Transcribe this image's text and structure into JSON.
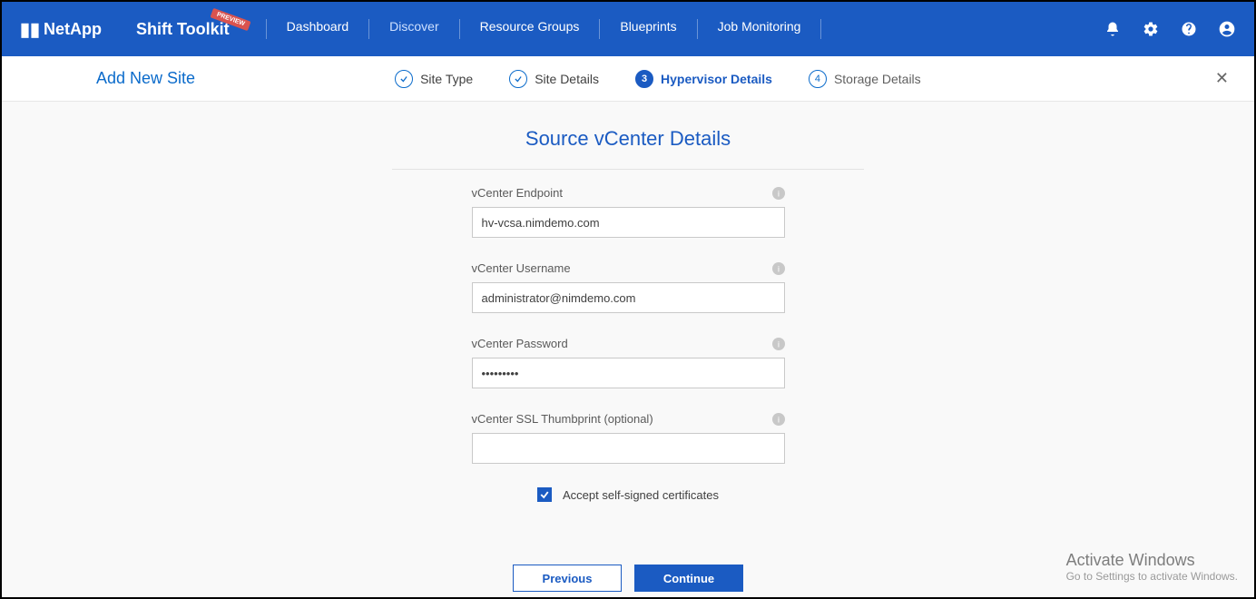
{
  "header": {
    "brand": "NetApp",
    "product": "Shift Toolkit",
    "badge": "PREVIEW",
    "nav": [
      {
        "label": "Dashboard"
      },
      {
        "label": "Discover"
      },
      {
        "label": "Resource Groups"
      },
      {
        "label": "Blueprints"
      },
      {
        "label": "Job Monitoring"
      }
    ]
  },
  "subbar": {
    "title": "Add New Site",
    "steps": {
      "s1": {
        "label": "Site Type"
      },
      "s2": {
        "label": "Site Details"
      },
      "s3": {
        "num": "3",
        "label": "Hypervisor Details"
      },
      "s4": {
        "num": "4",
        "label": "Storage Details"
      }
    }
  },
  "panel": {
    "title": "Source vCenter Details",
    "fields": {
      "endpoint": {
        "label": "vCenter Endpoint",
        "value": "hv-vcsa.nimdemo.com"
      },
      "username": {
        "label": "vCenter Username",
        "value": "administrator@nimdemo.com"
      },
      "password": {
        "label": "vCenter Password",
        "value": "•••••••••"
      },
      "thumbprint": {
        "label": "vCenter SSL Thumbprint (optional)",
        "value": ""
      }
    },
    "accept_self_signed_label": "Accept self-signed certificates",
    "accept_self_signed_checked": true
  },
  "buttons": {
    "previous": "Previous",
    "continue": "Continue"
  },
  "watermark": {
    "title": "Activate Windows",
    "sub": "Go to Settings to activate Windows."
  }
}
